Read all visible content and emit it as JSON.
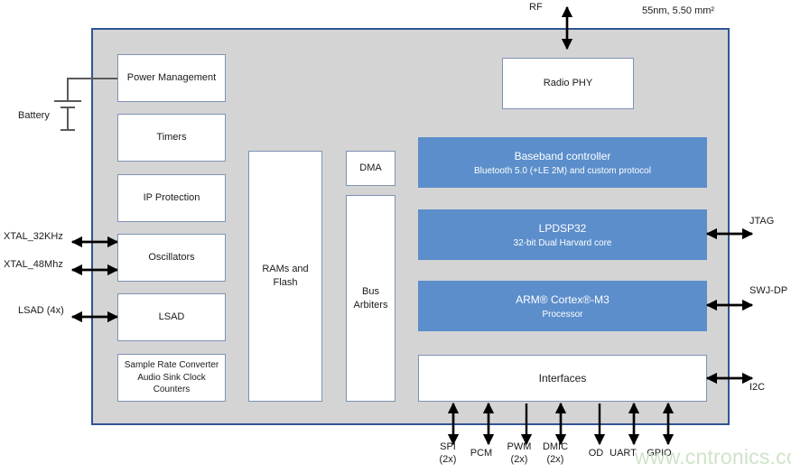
{
  "diagram": {
    "process_note": "55nm, 5.50 mm²",
    "watermark": "www.cntronics.com",
    "chip_fill": "#d4d4d4",
    "chip_border": "#2f5596",
    "block_fill": "#ffffff",
    "block_border": "#7c93b3",
    "core_fill": "#5b8ecb",
    "core_text": "#ffffff",
    "watermark_color": "#cfe3c8"
  },
  "external_labels": {
    "battery": "Battery",
    "rf": "RF",
    "xtal_32khz": "XTAL_32KHz",
    "xtal_48mhz": "XTAL_48Mhz",
    "lsad_4x": "LSAD (4x)",
    "jtag": "JTAG",
    "swj_dp": "SWJ-DP",
    "i2c": "I2C"
  },
  "left_blocks": [
    {
      "label": "Power Management"
    },
    {
      "label": "Timers"
    },
    {
      "label": "IP Protection"
    },
    {
      "label": "Oscillators"
    },
    {
      "label": "LSAD"
    },
    {
      "label_line1": "Sample Rate Converter",
      "label_line2": "Audio Sink Clock Counters"
    }
  ],
  "memory_block": {
    "line1": "RAMs and",
    "line2": "Flash"
  },
  "bus_blocks": [
    {
      "label": "DMA"
    },
    {
      "line1": "Bus",
      "line2": "Arbiters"
    }
  ],
  "radio_block": {
    "label": "Radio PHY"
  },
  "core_blocks": [
    {
      "title": "Baseband controller",
      "subtitle": "Bluetooth 5.0 (+LE 2M) and custom protocol"
    },
    {
      "title": "LPDSP32",
      "subtitle": "32-bit Dual Harvard core"
    },
    {
      "title": "ARM® Cortex®-M3",
      "subtitle": "Processor"
    }
  ],
  "interfaces_block": {
    "label": "Interfaces"
  },
  "interface_pins": [
    {
      "line1": "SPI",
      "line2": "(2x)",
      "direction": "bidirectional"
    },
    {
      "line1": "PCM",
      "line2": "",
      "direction": "bidirectional"
    },
    {
      "line1": "PWM",
      "line2": "(2x)",
      "direction": "out"
    },
    {
      "line1": "DMIC",
      "line2": "(2x)",
      "direction": "bidirectional"
    },
    {
      "line1": "OD",
      "line2": "",
      "direction": "out"
    },
    {
      "line1": "UART",
      "line2": "",
      "direction": "bidirectional"
    },
    {
      "line1": "GPIO",
      "line2": "",
      "direction": "bidirectional"
    }
  ]
}
